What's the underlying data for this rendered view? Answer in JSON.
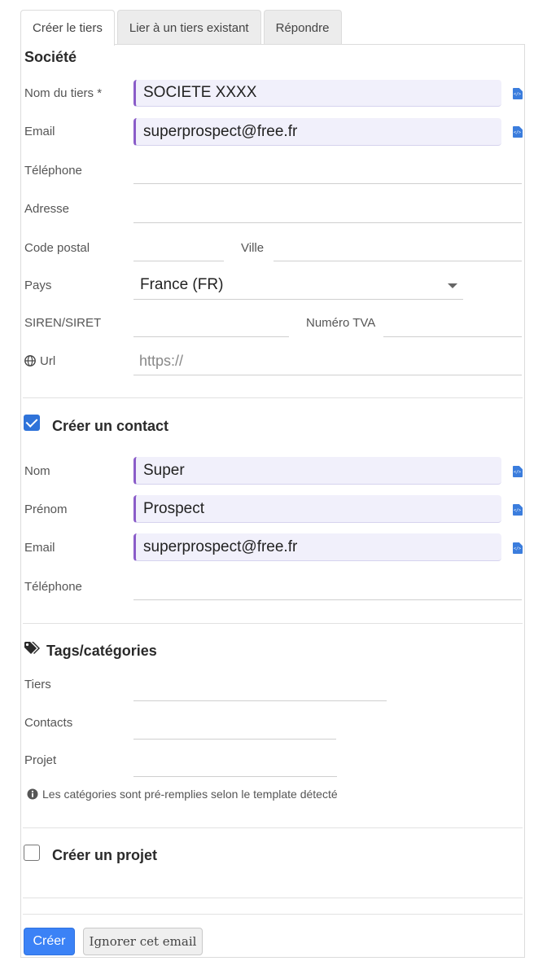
{
  "tabs": [
    "Créer le tiers",
    "Lier à un tiers existant",
    "Répondre"
  ],
  "company": {
    "title": "Société",
    "name_label": "Nom du tiers *",
    "name_value": "SOCIETE XXXX",
    "email_label": "Email",
    "email_value": "superprospect@free.fr",
    "phone_label": "Téléphone",
    "address_label": "Adresse",
    "zip_label": "Code postal",
    "city_label": "Ville",
    "country_label": "Pays",
    "country_value": "France (FR)",
    "siren_label": "SIREN/SIRET",
    "vat_label": "Numéro TVA",
    "url_label": "Url",
    "url_placeholder": "https://"
  },
  "contact": {
    "title": "Créer un contact",
    "checked": true,
    "lastname_label": "Nom",
    "lastname_value": "Super",
    "firstname_label": "Prénom",
    "firstname_value": "Prospect",
    "email_label": "Email",
    "email_value": "superprospect@free.fr",
    "phone_label": "Téléphone"
  },
  "tags": {
    "title": "Tags/catégories",
    "thirdparty_label": "Tiers",
    "contacts_label": "Contacts",
    "project_label": "Projet",
    "info": "Les catégories sont pré-remplies selon le template détecté"
  },
  "project": {
    "title": "Créer un projet",
    "checked": false
  },
  "actions": {
    "create": "Créer",
    "ignore": "Ignorer cet email"
  },
  "icons": {
    "field_source": "code-file-icon",
    "url": "globe-icon",
    "tags": "tags-icon",
    "info": "info-circle-icon"
  },
  "colors": {
    "accent": "#3b82f6",
    "filled_field_bg": "#f1f0fb",
    "filled_field_border": "#8a5cc9"
  }
}
